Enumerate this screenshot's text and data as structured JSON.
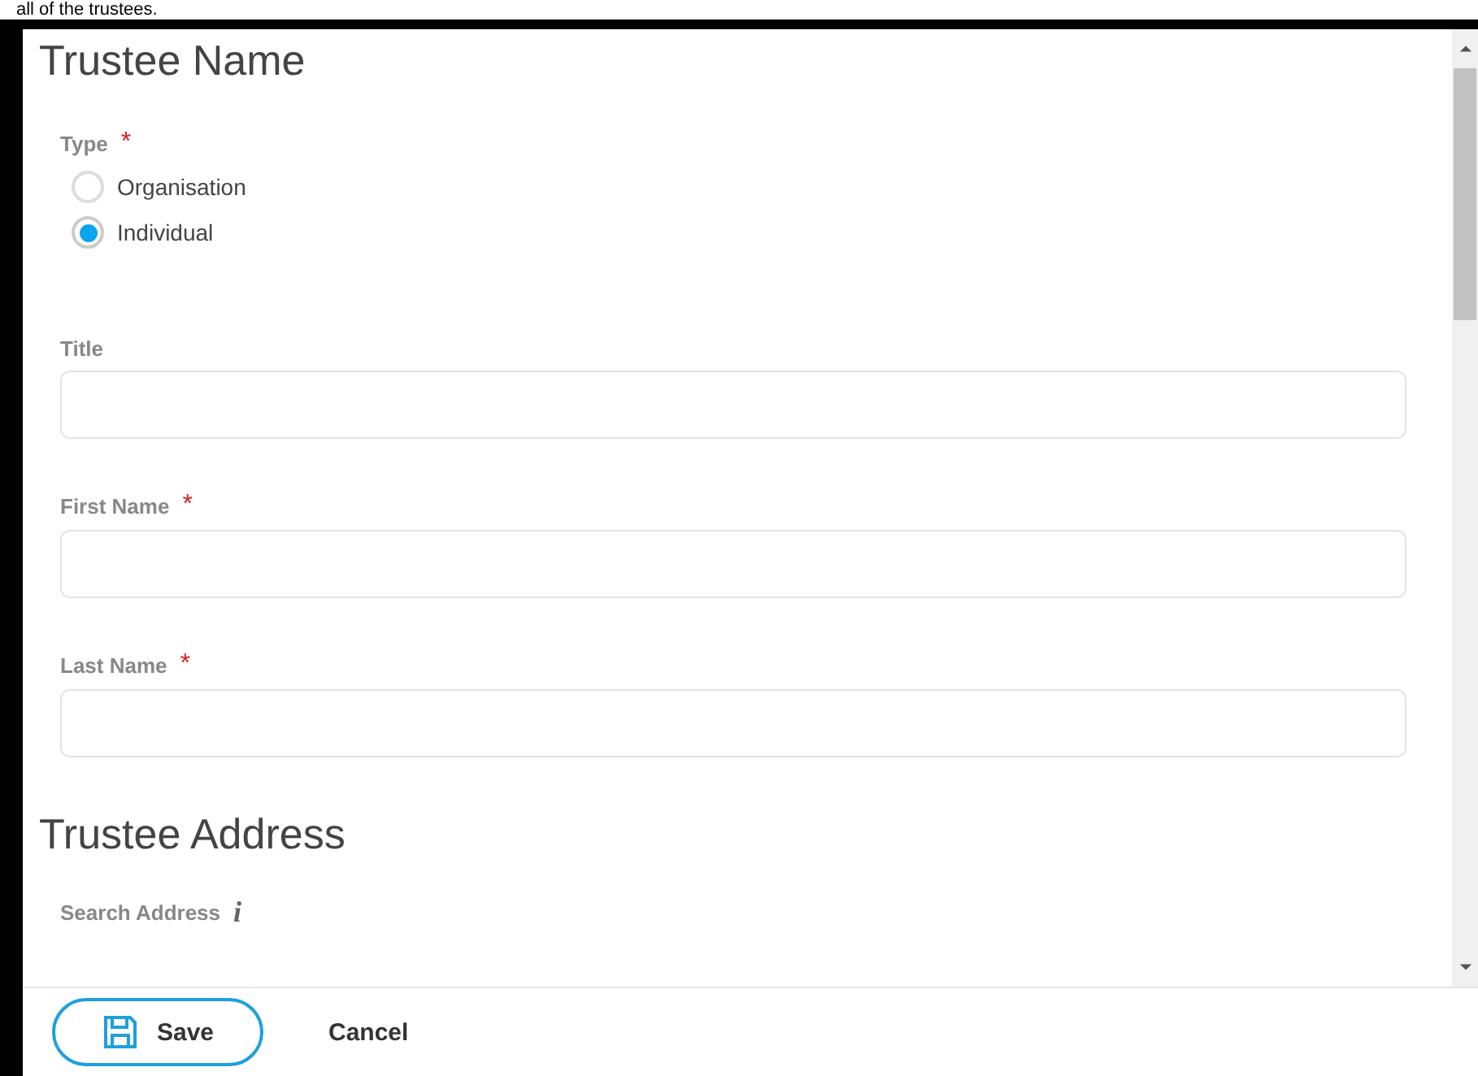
{
  "caption": "all of the trustees.",
  "required_marker": "*",
  "sections": [
    {
      "title": "Trustee Name",
      "fields": [
        {
          "kind": "radio",
          "label": "Type",
          "required": true,
          "options": [
            {
              "label": "Organisation",
              "selected": false
            },
            {
              "label": "Individual",
              "selected": true
            }
          ]
        },
        {
          "kind": "text",
          "label": "Title",
          "required": false
        },
        {
          "kind": "text",
          "label": "First Name",
          "required": true
        },
        {
          "kind": "text",
          "label": "Last Name",
          "required": true
        }
      ]
    },
    {
      "title": "Trustee Address",
      "fields": [
        {
          "kind": "search",
          "label": "Search Address",
          "info": "i"
        }
      ]
    }
  ],
  "footer": {
    "buttons": [
      {
        "label": "Save",
        "kind": "primary"
      },
      {
        "label": "Cancel",
        "kind": "plain"
      }
    ]
  }
}
